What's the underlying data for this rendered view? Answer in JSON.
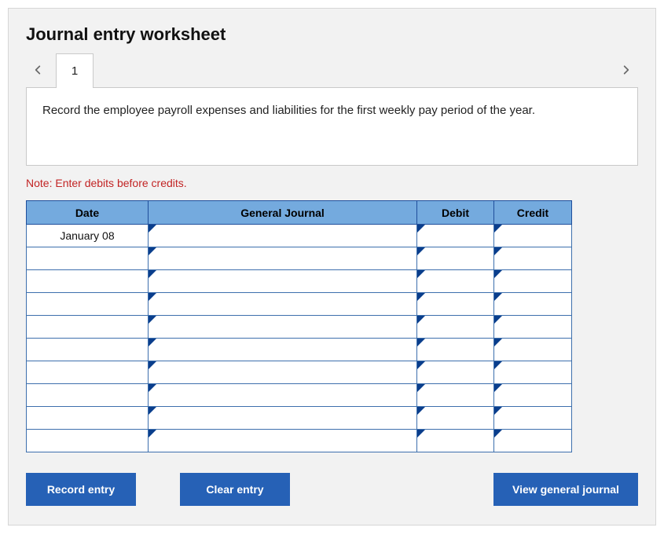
{
  "title": "Journal entry worksheet",
  "nav": {
    "prev_icon": "chevron-left",
    "next_icon": "chevron-right"
  },
  "tabs": [
    {
      "label": "1"
    }
  ],
  "instruction": "Record the employee payroll expenses and liabilities for the first weekly pay period of the year.",
  "note": "Note: Enter debits before credits.",
  "table": {
    "headers": {
      "date": "Date",
      "gj": "General Journal",
      "debit": "Debit",
      "credit": "Credit"
    },
    "rows": [
      {
        "date": "January 08",
        "gj": "",
        "debit": "",
        "credit": ""
      },
      {
        "date": "",
        "gj": "",
        "debit": "",
        "credit": ""
      },
      {
        "date": "",
        "gj": "",
        "debit": "",
        "credit": ""
      },
      {
        "date": "",
        "gj": "",
        "debit": "",
        "credit": ""
      },
      {
        "date": "",
        "gj": "",
        "debit": "",
        "credit": ""
      },
      {
        "date": "",
        "gj": "",
        "debit": "",
        "credit": ""
      },
      {
        "date": "",
        "gj": "",
        "debit": "",
        "credit": ""
      },
      {
        "date": "",
        "gj": "",
        "debit": "",
        "credit": ""
      },
      {
        "date": "",
        "gj": "",
        "debit": "",
        "credit": ""
      },
      {
        "date": "",
        "gj": "",
        "debit": "",
        "credit": ""
      }
    ]
  },
  "buttons": {
    "record": "Record entry",
    "clear": "Clear entry",
    "view": "View general journal"
  },
  "colors": {
    "header_bg": "#74aade",
    "btn_bg": "#2661b6",
    "note": "#c22424"
  }
}
